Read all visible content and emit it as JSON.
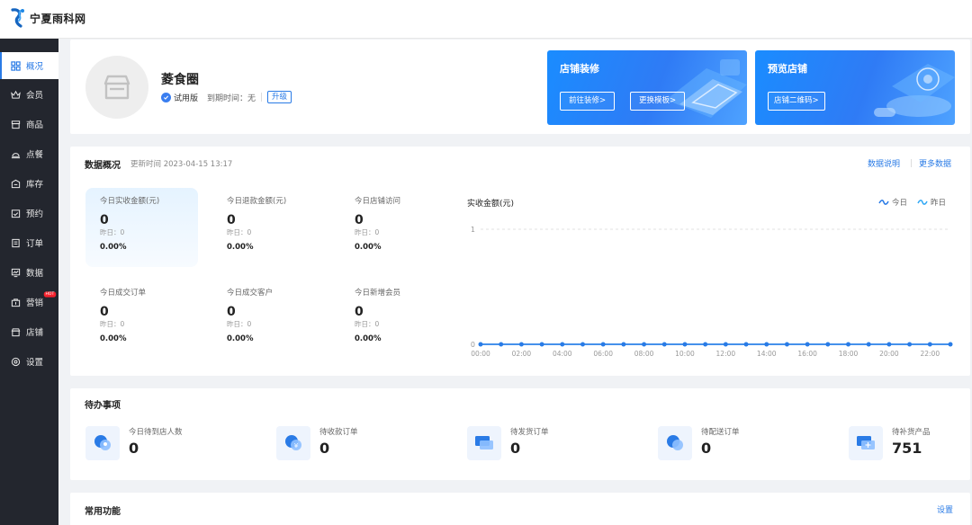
{
  "app": {
    "logo_text": "宁夏雨科网"
  },
  "sidebar": {
    "items": [
      {
        "label": "概况",
        "icon": "dashboard-icon",
        "active": true
      },
      {
        "label": "会员",
        "icon": "crown-icon"
      },
      {
        "label": "商品",
        "icon": "goods-icon"
      },
      {
        "label": "点餐",
        "icon": "dining-icon"
      },
      {
        "label": "库存",
        "icon": "inventory-icon"
      },
      {
        "label": "预约",
        "icon": "calendar-icon"
      },
      {
        "label": "订单",
        "icon": "order-icon"
      },
      {
        "label": "数据",
        "icon": "data-icon"
      },
      {
        "label": "营销",
        "icon": "marketing-icon",
        "badge": "HOT"
      },
      {
        "label": "店铺",
        "icon": "shop-icon"
      },
      {
        "label": "设置",
        "icon": "settings-icon"
      }
    ]
  },
  "store": {
    "name": "菱食圈",
    "version": "试用版",
    "expire": "到期时间：无",
    "upgrade": "升级"
  },
  "banners": [
    {
      "title": "店铺装修",
      "buttons": [
        "前往装修>",
        "更换模板>"
      ]
    },
    {
      "title": "预览店铺",
      "buttons": [
        "店铺二维码>"
      ]
    }
  ],
  "overview": {
    "title": "数据概况",
    "update_time": "更新时间 2023-04-15 13:17",
    "link_explain": "数据说明",
    "link_more": "更多数据",
    "metrics": [
      {
        "label": "今日实收金额(元)",
        "value": "0",
        "yesterday": "昨日：0",
        "percent": "0.00%"
      },
      {
        "label": "今日退款金额(元)",
        "value": "0",
        "yesterday": "昨日：0",
        "percent": "0.00%"
      },
      {
        "label": "今日店铺访问",
        "value": "0",
        "yesterday": "昨日：0",
        "percent": "0.00%"
      },
      {
        "label": "今日成交订单",
        "value": "0",
        "yesterday": "昨日：0",
        "percent": "0.00%"
      },
      {
        "label": "今日成交客户",
        "value": "0",
        "yesterday": "昨日：0",
        "percent": "0.00%"
      },
      {
        "label": "今日新增会员",
        "value": "0",
        "yesterday": "昨日：0",
        "percent": "0.00%"
      }
    ]
  },
  "chart_data": {
    "type": "line",
    "title": "实收金额(元)",
    "xlabel": "",
    "ylabel": "",
    "ylim": [
      0,
      1
    ],
    "y_ticks": [
      "0",
      "1"
    ],
    "x": [
      "00:00",
      "01:00",
      "02:00",
      "03:00",
      "04:00",
      "05:00",
      "06:00",
      "07:00",
      "08:00",
      "09:00",
      "10:00",
      "11:00",
      "12:00",
      "13:00",
      "14:00",
      "15:00",
      "16:00",
      "17:00",
      "18:00",
      "19:00",
      "20:00",
      "21:00",
      "22:00",
      "23:00"
    ],
    "x_tick_labels": [
      "00:00",
      "02:00",
      "04:00",
      "06:00",
      "08:00",
      "10:00",
      "12:00",
      "14:00",
      "16:00",
      "18:00",
      "20:00",
      "22:00"
    ],
    "series": [
      {
        "name": "今日",
        "color": "#2a7be6",
        "values": [
          0,
          0,
          0,
          0,
          0,
          0,
          0,
          0,
          0,
          0,
          0,
          0,
          0,
          0,
          0,
          0,
          0,
          0,
          0,
          0,
          0,
          0,
          0,
          0
        ]
      },
      {
        "name": "昨日",
        "color": "#33a9f5",
        "values": [
          0,
          0,
          0,
          0,
          0,
          0,
          0,
          0,
          0,
          0,
          0,
          0,
          0,
          0,
          0,
          0,
          0,
          0,
          0,
          0,
          0,
          0,
          0,
          0
        ]
      }
    ],
    "grid": true,
    "legend": "top-right"
  },
  "todo": {
    "title": "待办事项",
    "items": [
      {
        "label": "今日待到店人数",
        "value": "0",
        "icon": "person-icon"
      },
      {
        "label": "待收款订单",
        "value": "0",
        "icon": "yuan-icon"
      },
      {
        "label": "待发货订单",
        "value": "0",
        "icon": "shipment-icon"
      },
      {
        "label": "待配送订单",
        "value": "0",
        "icon": "delivery-icon"
      },
      {
        "label": "待补货产品",
        "value": "751",
        "icon": "restock-icon"
      }
    ]
  },
  "common": {
    "title": "常用功能",
    "setting": "设置"
  }
}
